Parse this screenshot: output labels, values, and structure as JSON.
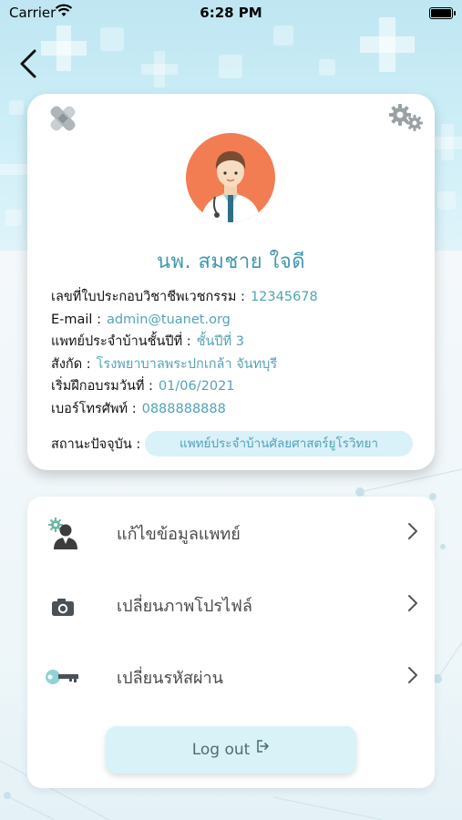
{
  "status_bar": {
    "carrier": "Carrier",
    "time": "6:28 PM"
  },
  "profile": {
    "name": "นพ. สมชาย ใจดี",
    "fields": [
      {
        "label": "เลขที่ใบประกอบวิชาชีพเวชกรรม :",
        "value": "12345678"
      },
      {
        "label": "E-mail :",
        "value": "admin@tuanet.org"
      },
      {
        "label": "แพทย์ประจำบ้านชั้นปีที่ :",
        "value": "ชั้นปีที่ 3"
      },
      {
        "label": "สังกัด :",
        "value": "โรงพยาบาลพระปกเกล้า จันทบุรี"
      },
      {
        "label": "เริ่มฝึกอบรมวันที่ :",
        "value": "01/06/2021"
      },
      {
        "label": "เบอร์โทรศัพท์ :",
        "value": "0888888888"
      }
    ],
    "status_label": "สถานะปัจจุบัน :",
    "status_value": "แพทย์ประจำบ้านศัลยศาสตร์ยูโรวิทยา"
  },
  "menu": {
    "items": [
      {
        "label": "แก้ไขข้อมูลแพทย์",
        "icon": "doctor-gear-icon"
      },
      {
        "label": "เปลี่ยนภาพโปรไฟล์",
        "icon": "camera-icon"
      },
      {
        "label": "เปลี่ยนรหัสผ่าน",
        "icon": "key-icon"
      }
    ],
    "logout_label": "Log out"
  },
  "colors": {
    "accent": "#52a3b7",
    "avatar_bg": "#f27d53",
    "pill_bg": "#d9f1f8"
  }
}
